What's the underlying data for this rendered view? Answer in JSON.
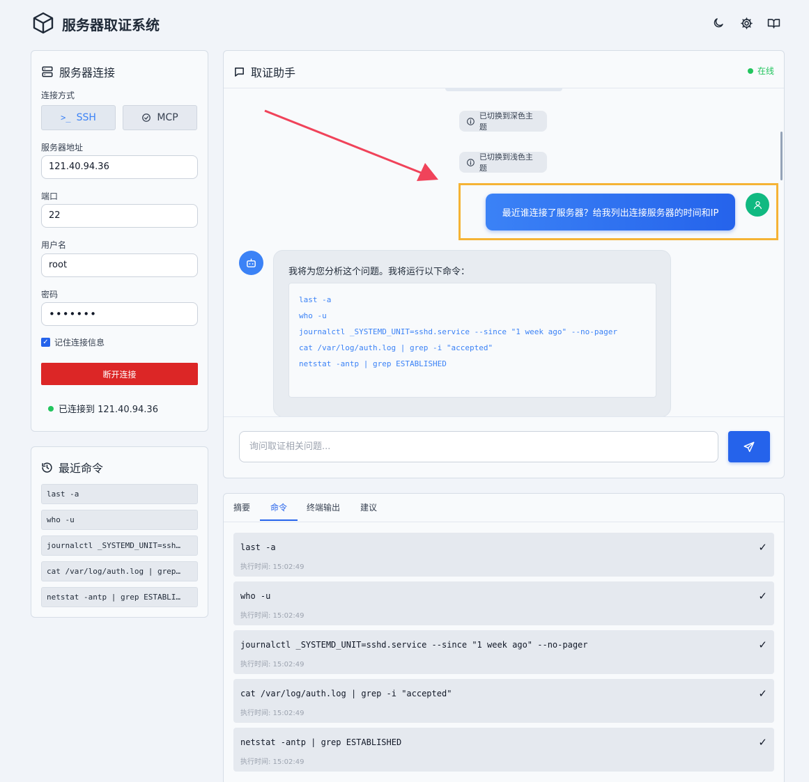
{
  "header": {
    "title": "服务器取证系统",
    "icons": [
      "cube-logo-icon",
      "moon-icon",
      "gear-icon",
      "book-icon"
    ]
  },
  "connection": {
    "title": "服务器连接",
    "method_label": "连接方式",
    "ssh_label": "SSH",
    "mcp_label": "MCP",
    "address_label": "服务器地址",
    "address_value": "121.40.94.36",
    "port_label": "端口",
    "port_value": "22",
    "user_label": "用户名",
    "user_value": "root",
    "password_label": "密码",
    "password_value": "•••••••",
    "remember_label": "记住连接信息",
    "disconnect_label": "断开连接",
    "status_text": "已连接到 121.40.94.36"
  },
  "recent": {
    "title": "最近命令",
    "items": [
      "last -a",
      "who -u",
      "journalctl _SYSTEMD_UNIT=ssh…",
      "cat /var/log/auth.log | grep…",
      "netstat -antp | grep ESTABLI…"
    ]
  },
  "chat": {
    "title": "取证助手",
    "status": "在线",
    "system_messages": [
      "已切换到深色主题",
      "已切换到浅色主题"
    ],
    "user_message": "最近谁连接了服务器？给我列出连接服务器的时间和IP",
    "bot_intro": "我将为您分析这个问题。我将运行以下命令：",
    "bot_commands": [
      "last -a",
      "who -u",
      "journalctl _SYSTEMD_UNIT=sshd.service --since \"1 week ago\" --no-pager",
      "cat /var/log/auth.log | grep -i \"accepted\"",
      "netstat -antp | grep ESTABLISHED"
    ],
    "input_placeholder": "询问取证相关问题..."
  },
  "tabs": {
    "items": [
      "摘要",
      "命令",
      "终端输出",
      "建议"
    ],
    "active": "命令"
  },
  "commands": [
    {
      "cmd": "last -a",
      "time": "执行时间: 15:02:49",
      "status": "✓"
    },
    {
      "cmd": "who -u",
      "time": "执行时间: 15:02:49",
      "status": "✓"
    },
    {
      "cmd": "journalctl _SYSTEMD_UNIT=sshd.service --since \"1 week ago\" --no-pager",
      "time": "执行时间: 15:02:49",
      "status": "✓"
    },
    {
      "cmd": "cat /var/log/auth.log | grep -i \"accepted\"",
      "time": "执行时间: 15:02:49",
      "status": "✓"
    },
    {
      "cmd": "netstat -antp | grep ESTABLISHED",
      "time": "执行时间: 15:02:49",
      "status": "✓"
    }
  ],
  "colors": {
    "primary": "#2563eb",
    "danger": "#dc2626",
    "success": "#22c55e",
    "highlight": "#f5b335",
    "arrow": "#f0435a"
  }
}
